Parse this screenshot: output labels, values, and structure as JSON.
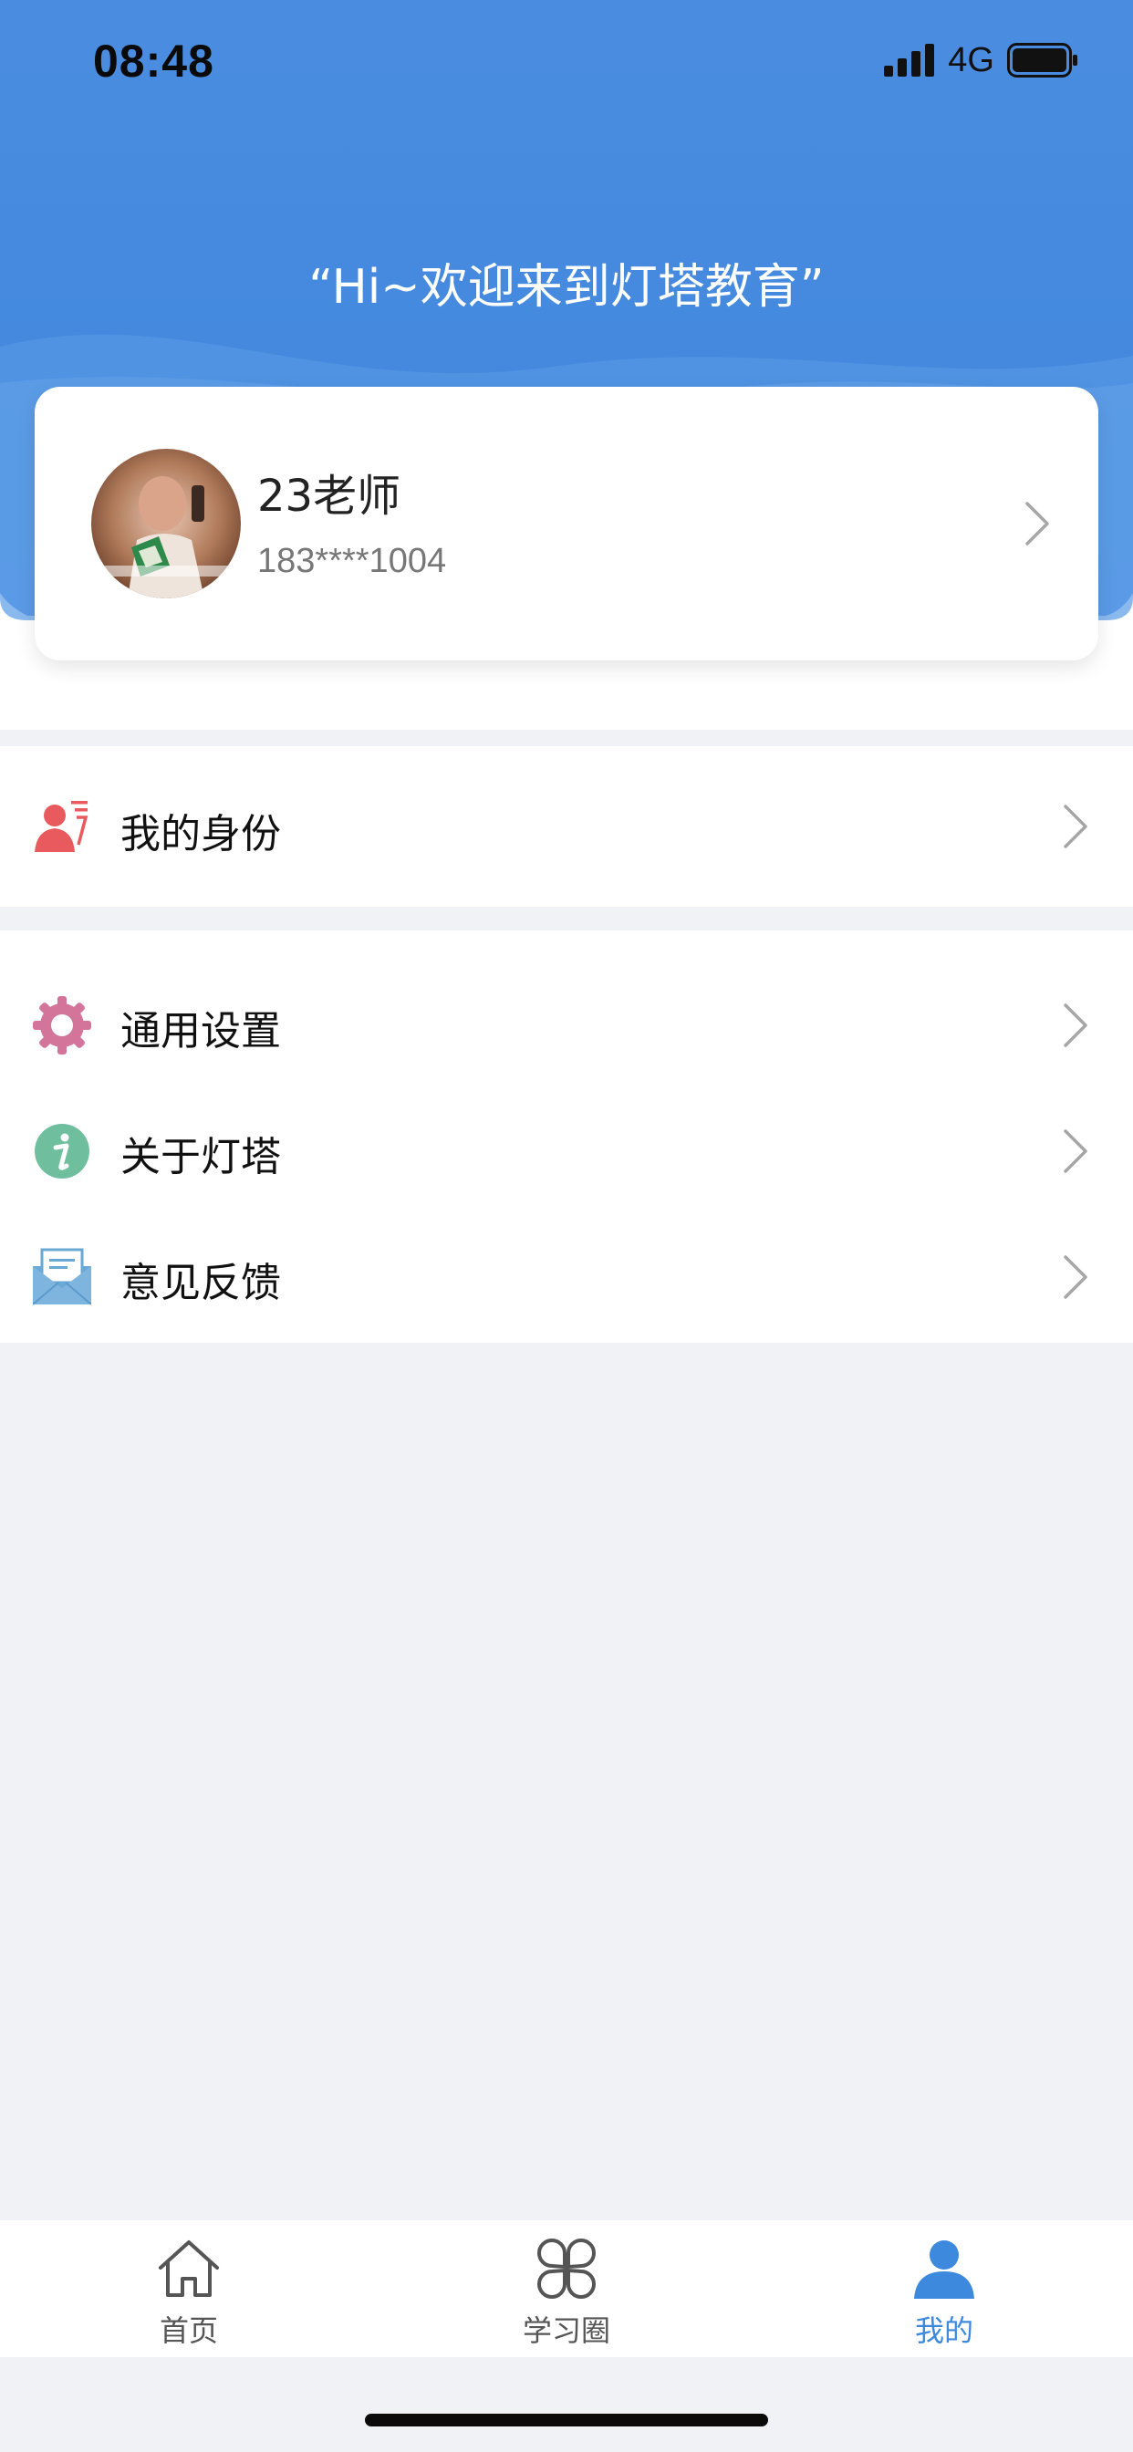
{
  "status_bar": {
    "time": "08:48",
    "network": "4G"
  },
  "header": {
    "welcome": "“Hi~欢迎来到灯塔教育”"
  },
  "profile": {
    "name": "23老师",
    "phone": "183****1004"
  },
  "menu": {
    "section1": [
      {
        "label": "我的身份",
        "icon": "id-card-icon"
      }
    ],
    "section2": [
      {
        "label": "通用设置",
        "icon": "gear-icon"
      },
      {
        "label": "关于灯塔",
        "icon": "info-icon"
      },
      {
        "label": "意见反馈",
        "icon": "mail-icon"
      }
    ]
  },
  "tabbar": {
    "tabs": [
      {
        "label": "首页",
        "icon": "home-icon"
      },
      {
        "label": "学习圈",
        "icon": "clover-icon"
      },
      {
        "label": "我的",
        "icon": "person-icon",
        "active": true
      }
    ]
  },
  "colors": {
    "header_blue": "#4a8de0",
    "accent": "#3d89de"
  }
}
